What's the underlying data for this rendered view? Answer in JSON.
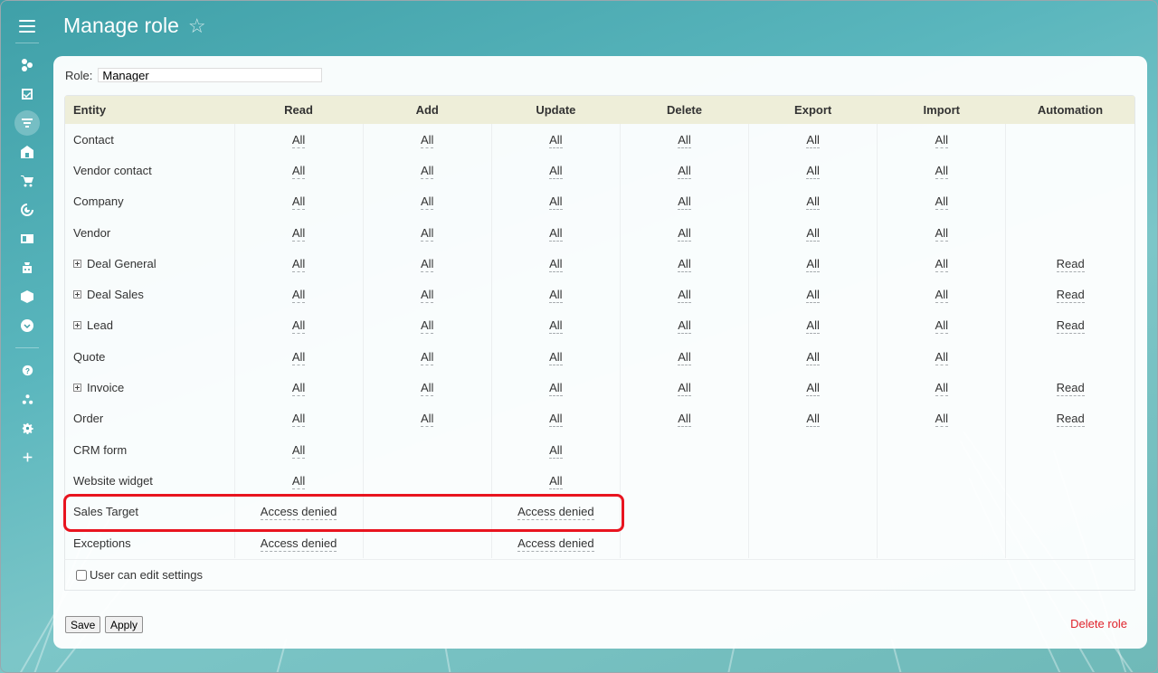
{
  "page": {
    "title": "Manage role"
  },
  "role": {
    "label": "Role:",
    "value": "Manager"
  },
  "table": {
    "headers": [
      "Entity",
      "Read",
      "Add",
      "Update",
      "Delete",
      "Export",
      "Import",
      "Automation"
    ],
    "rows": [
      {
        "entity": "Contact",
        "expandable": false,
        "cells": [
          "All",
          "All",
          "All",
          "All",
          "All",
          "All",
          ""
        ]
      },
      {
        "entity": "Vendor contact",
        "expandable": false,
        "cells": [
          "All",
          "All",
          "All",
          "All",
          "All",
          "All",
          ""
        ]
      },
      {
        "entity": "Company",
        "expandable": false,
        "cells": [
          "All",
          "All",
          "All",
          "All",
          "All",
          "All",
          ""
        ]
      },
      {
        "entity": "Vendor",
        "expandable": false,
        "cells": [
          "All",
          "All",
          "All",
          "All",
          "All",
          "All",
          ""
        ]
      },
      {
        "entity": "Deal General",
        "expandable": true,
        "cells": [
          "All",
          "All",
          "All",
          "All",
          "All",
          "All",
          "Read"
        ]
      },
      {
        "entity": "Deal Sales",
        "expandable": true,
        "cells": [
          "All",
          "All",
          "All",
          "All",
          "All",
          "All",
          "Read"
        ]
      },
      {
        "entity": "Lead",
        "expandable": true,
        "cells": [
          "All",
          "All",
          "All",
          "All",
          "All",
          "All",
          "Read"
        ]
      },
      {
        "entity": "Quote",
        "expandable": false,
        "cells": [
          "All",
          "All",
          "All",
          "All",
          "All",
          "All",
          ""
        ]
      },
      {
        "entity": "Invoice",
        "expandable": true,
        "cells": [
          "All",
          "All",
          "All",
          "All",
          "All",
          "All",
          "Read"
        ]
      },
      {
        "entity": "Order",
        "expandable": false,
        "cells": [
          "All",
          "All",
          "All",
          "All",
          "All",
          "All",
          "Read"
        ]
      },
      {
        "entity": "CRM form",
        "expandable": false,
        "cells": [
          "All",
          "",
          "All",
          "",
          "",
          "",
          ""
        ]
      },
      {
        "entity": "Website widget",
        "expandable": false,
        "cells": [
          "All",
          "",
          "All",
          "",
          "",
          "",
          ""
        ]
      },
      {
        "entity": "Sales Target",
        "expandable": false,
        "cells": [
          "Access denied",
          "",
          "Access denied",
          "",
          "",
          "",
          ""
        ]
      },
      {
        "entity": "Exceptions",
        "expandable": false,
        "cells": [
          "Access denied",
          "",
          "Access denied",
          "",
          "",
          "",
          ""
        ]
      }
    ]
  },
  "settings": {
    "user_can_edit_label": "User can edit settings",
    "checked": false
  },
  "buttons": {
    "save": "Save",
    "apply": "Apply",
    "delete_role": "Delete role"
  },
  "sidebar": {
    "icons": [
      "menu-icon",
      "activity-stream-icon",
      "tasks-icon",
      "crm-icon",
      "sites-icon",
      "shop-icon",
      "marketing-icon",
      "contact-center-icon",
      "automation-icon",
      "inventory-icon",
      "more-icon",
      "help-icon",
      "sitemap-icon",
      "settings-icon",
      "add-icon"
    ]
  },
  "colors": {
    "highlight": "#e8141f",
    "delete_link": "#e0222a",
    "table_header": "#eeeed9"
  }
}
